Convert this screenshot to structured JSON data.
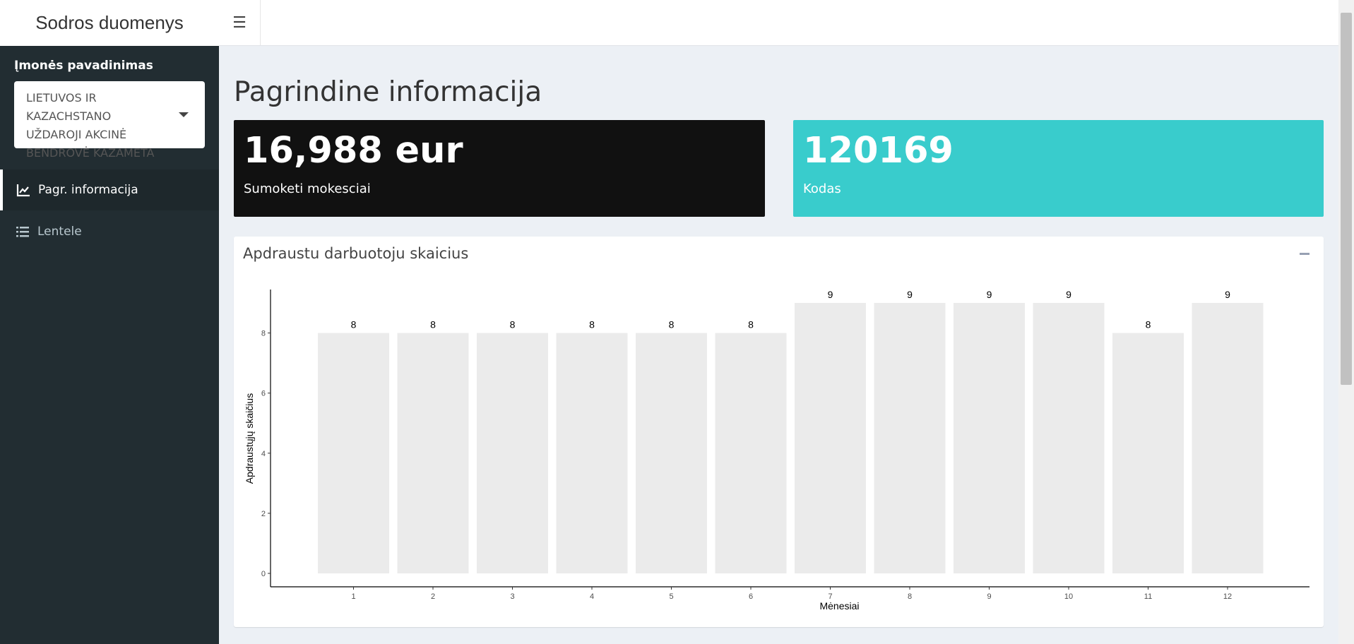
{
  "app": {
    "title": "Sodros duomenys"
  },
  "header": {
    "toggle_icon": "hamburger-icon"
  },
  "sidebar": {
    "company_label": "Įmonės pavadinimas",
    "company_select_value": "LIETUVOS IR KAZACHSTANO UŽDAROJI AKCINĖ BENDROVĖ KAZAMETA",
    "menu": [
      {
        "label": "Pagr. informacija",
        "icon": "line-chart-icon",
        "active": true
      },
      {
        "label": "Lentele",
        "icon": "list-icon",
        "active": false
      }
    ]
  },
  "main": {
    "title": "Pagrindine informacija",
    "value_boxes": [
      {
        "value": "16,988 eur",
        "subtitle": "Sumoketi mokesciai",
        "color": "#111111"
      },
      {
        "value": "120169",
        "subtitle": "Kodas",
        "color": "#39cccc"
      }
    ],
    "chart_box": {
      "title": "Apdraustu darbuotoju skaicius"
    }
  },
  "chart_data": {
    "type": "bar",
    "categories": [
      "1",
      "2",
      "3",
      "4",
      "5",
      "6",
      "7",
      "8",
      "9",
      "10",
      "11",
      "12"
    ],
    "values": [
      8,
      8,
      8,
      8,
      8,
      8,
      9,
      9,
      9,
      9,
      8,
      9
    ],
    "xlabel": "Mėnesiai",
    "ylabel": "Apdraustųjų skaičius",
    "yticks": [
      0,
      2,
      4,
      6,
      8
    ],
    "ylim": [
      0,
      9.4
    ],
    "bar_color": "#ebebeb",
    "data_labels": true,
    "grid": false
  }
}
